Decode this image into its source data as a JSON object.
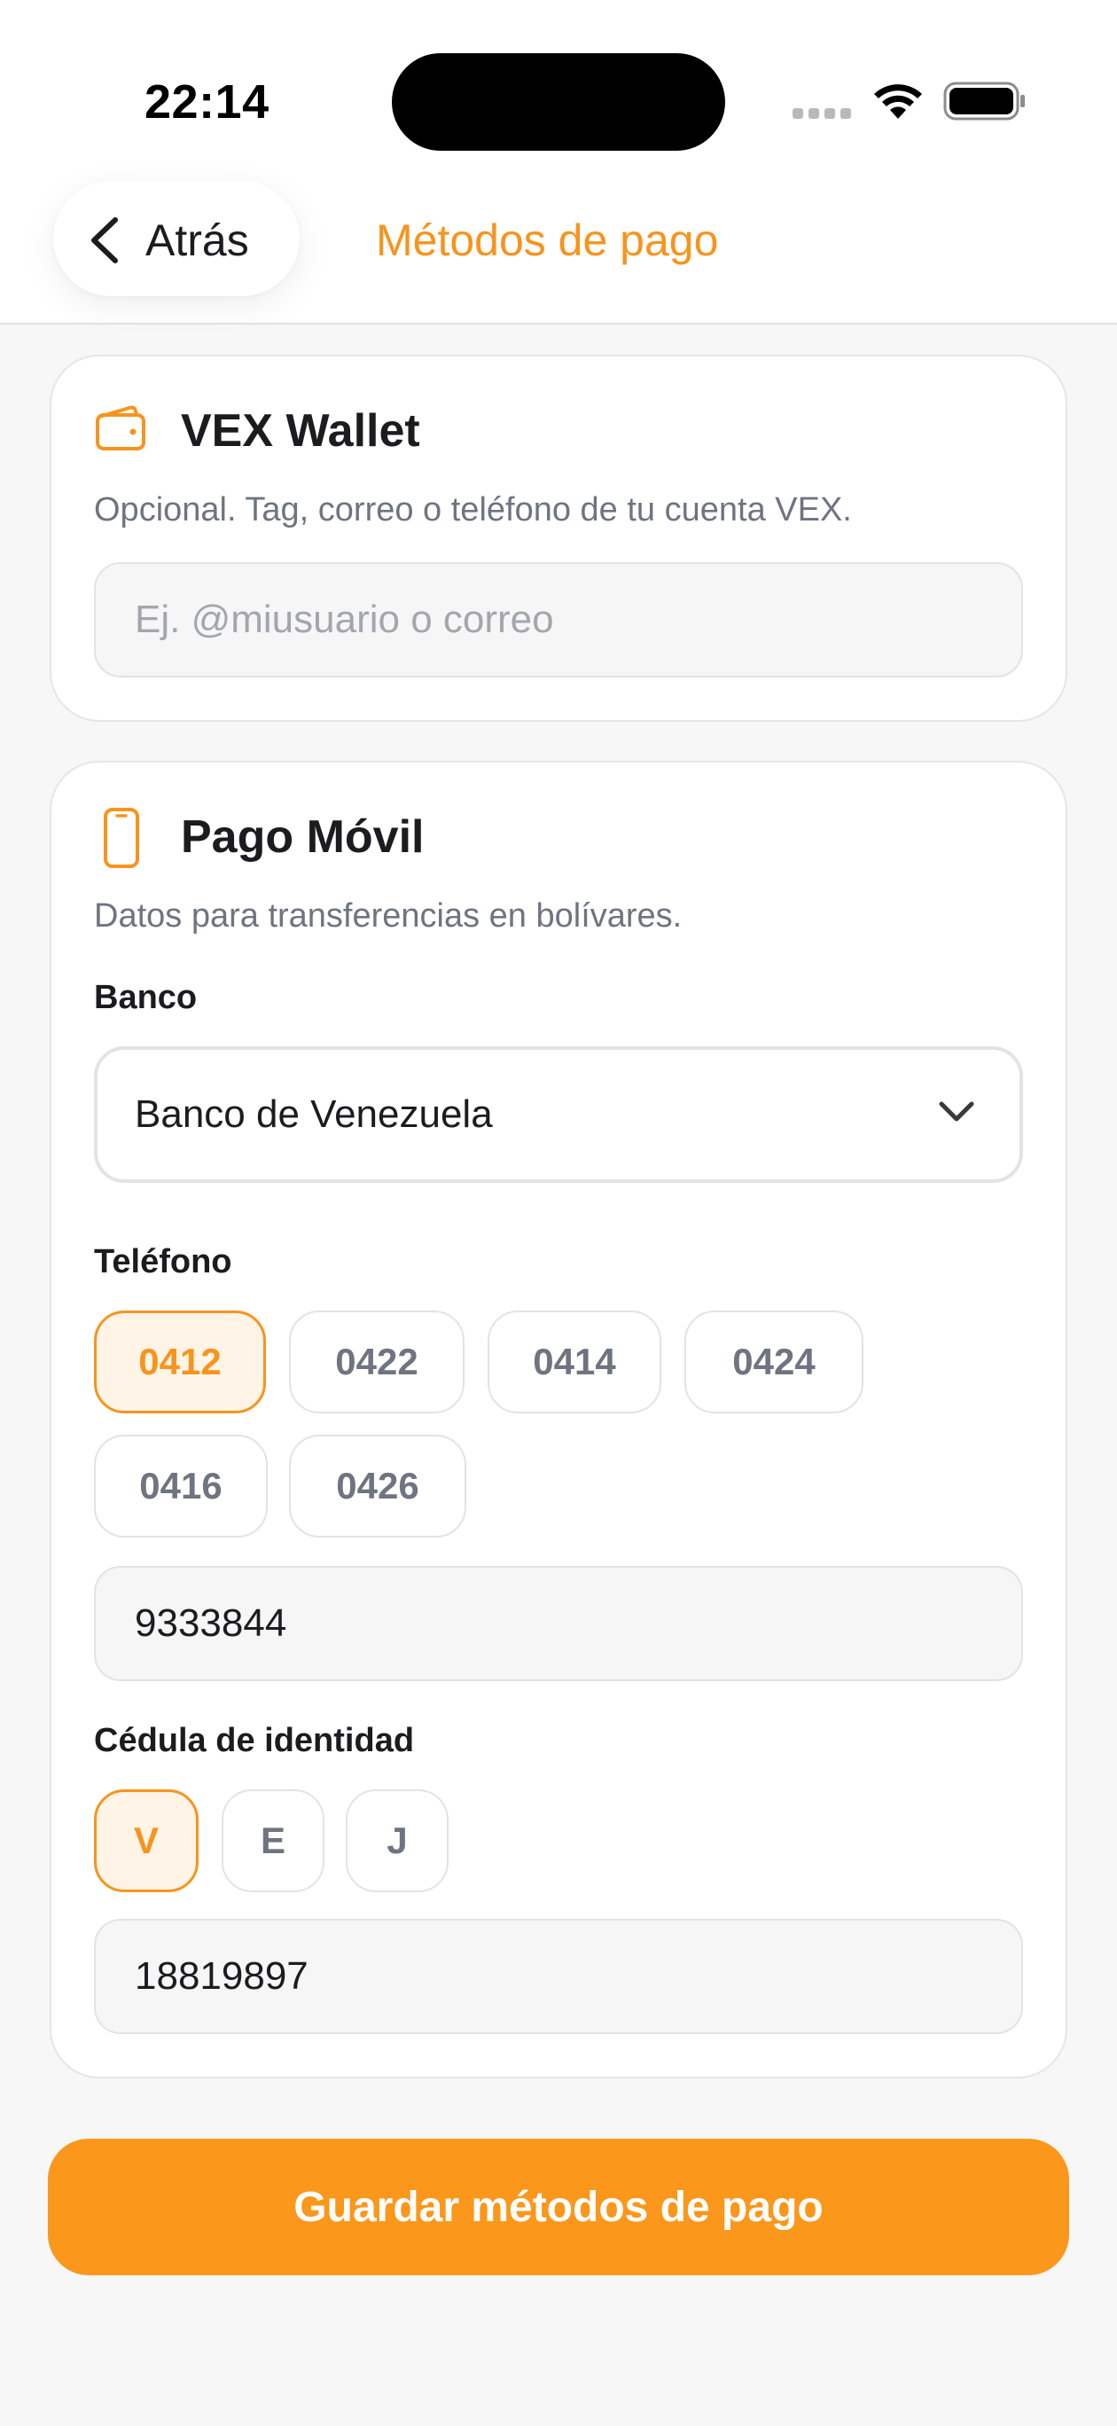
{
  "status_bar": {
    "time": "22:14"
  },
  "header": {
    "back_label": "Atrás",
    "title": "Métodos de pago"
  },
  "wallet": {
    "title": "VEX Wallet",
    "subtitle": "Opcional. Tag, correo o teléfono de tu cuenta VEX.",
    "input_value": "",
    "input_placeholder": "Ej. @miusuario o correo"
  },
  "pago_movil": {
    "title": "Pago Móvil",
    "subtitle": "Datos para transferencias en bolívares.",
    "bank_label": "Banco",
    "bank_selected": "Banco de Venezuela",
    "phone_label": "Teléfono",
    "phone_prefixes": [
      "0412",
      "0422",
      "0414",
      "0424",
      "0416",
      "0426"
    ],
    "phone_prefix_selected": "0412",
    "phone_number": "9333844",
    "id_label": "Cédula de identidad",
    "id_types": [
      "V",
      "E",
      "J"
    ],
    "id_type_selected": "V",
    "id_number": "18819897"
  },
  "actions": {
    "save_label": "Guardar métodos de pago"
  },
  "colors": {
    "accent": "#f7941d",
    "accent_bg": "#fff4e6",
    "button": "#fb971a"
  },
  "icons": {
    "back": "chevron-left-icon",
    "wallet": "wallet-icon",
    "phone": "smartphone-icon",
    "dropdown": "chevron-down-icon"
  }
}
